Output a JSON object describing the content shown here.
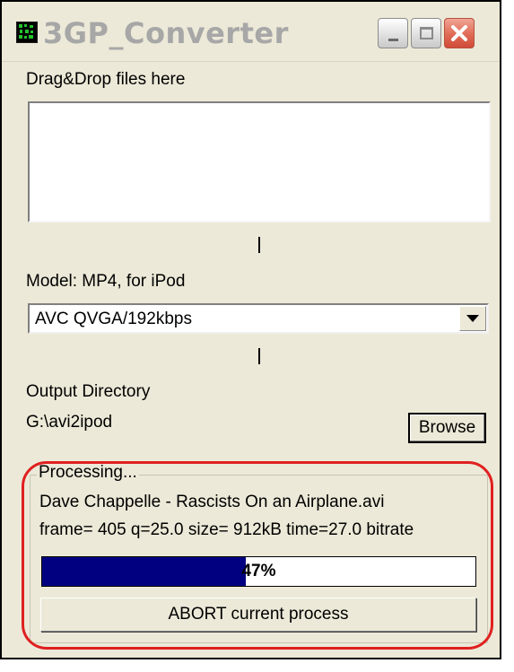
{
  "window": {
    "title": "3GP_Converter",
    "controls": {
      "minimize": "minimize-icon",
      "maximize": "maximize-icon",
      "close": "close-icon"
    }
  },
  "dropzone": {
    "label": "Drag&Drop files here"
  },
  "model": {
    "label": "Model: MP4, for iPod",
    "selected": "AVC QVGA/192kbps"
  },
  "output": {
    "label": "Output Directory",
    "path": "G:\\avi2ipod",
    "browse_label": "Browse"
  },
  "processing": {
    "group_label": "Processing...",
    "filename": "Dave Chappelle - Rascists On an Airplane.avi",
    "status_line": "frame=  405 q=25.0 size=    912kB time=27.0 bitrate",
    "progress_percent": 47,
    "progress_text": "47%",
    "abort_label": "ABORT current process"
  },
  "colors": {
    "progress_fill": "#000080",
    "highlight": "#e02020",
    "window_bg": "#ece9d8"
  }
}
